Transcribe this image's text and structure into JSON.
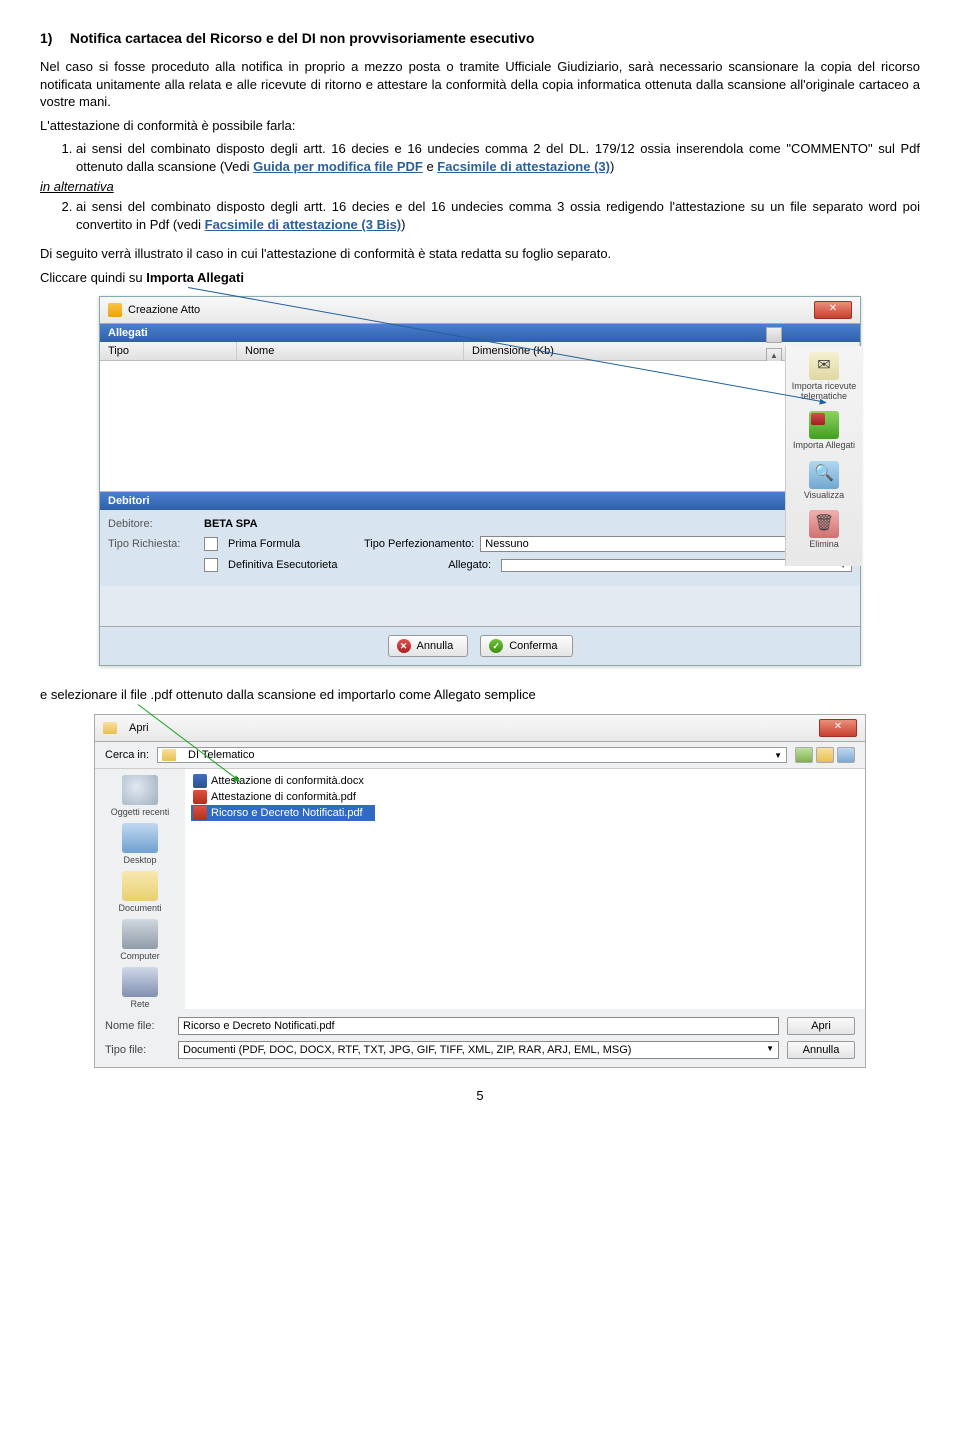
{
  "heading": {
    "number": "1)",
    "title": "Notifica cartacea del Ricorso e del DI non provvisoriamente esecutivo"
  },
  "p1": "Nel caso si fosse proceduto alla notifica in proprio a mezzo posta o tramite Ufficiale Giudiziario, sarà necessario scansionare la copia del ricorso notificata unitamente alla relata e alle ricevute di ritorno e attestare la conformità della copia informatica ottenuta dalla scansione all'originale cartaceo a vostre mani.",
  "p2": "L'attestazione di conformità è possibile farla:",
  "li1a": "ai sensi del combinato disposto degli artt. 16 decies e 16 undecies comma 2 del DL. 179/12 ossia inserendola come \"COMMENTO\" sul Pdf ottenuto dalla scansione (Vedi ",
  "link1": "Guida per modifica file PDF",
  "li1b": " e ",
  "link2": "Facsimile di attestazione (3)",
  "li1c": ")",
  "alt": "in alternativa",
  "li2a": "ai sensi del combinato disposto degli artt. 16 decies e del 16 undecies comma 3 ossia redigendo l'attestazione su un file separato word poi convertito in Pdf (vedi ",
  "link3": "Facsimile di attestazione (3 Bis)",
  "li2b": ")",
  "p3a": "Di seguito verrà illustrato il caso in cui l'attestazione di conformità è stata redatta su foglio separato.",
  "p4a": "Cliccare quindi su ",
  "p4b": "Importa Allegati",
  "shot1": {
    "title": "Creazione Atto",
    "sec1": "Allegati",
    "th1": "Tipo",
    "th2": "Nome",
    "th3": "Dimensione (Kb)",
    "tool1": "Importa ricevute telematiche",
    "tool2": "Importa Allegati",
    "tool3": "Visualizza",
    "tool4": "Elimina",
    "sec2": "Debitori",
    "dl1": "Debitore:",
    "dv1": "BETA SPA",
    "dl2": "Tipo Richiesta:",
    "chk1": "Prima Formula",
    "dl3": "Tipo Perfezionamento:",
    "sel1": "Nessuno",
    "chk2": "Definitiva Esecutorieta",
    "dl4": "Allegato:",
    "btn1": "Annulla",
    "btn2": "Conferma"
  },
  "p5": "e selezionare il file .pdf ottenuto dalla scansione ed importarlo come Allegato semplice",
  "shot2": {
    "title": "Apri",
    "loc_label": "Cerca in:",
    "loc_val": "DI Telematico",
    "place1": "Oggetti recenti",
    "place2": "Desktop",
    "place3": "Documenti",
    "place4": "Computer",
    "place5": "Rete",
    "file1": "Attestazione di conformità.docx",
    "file2": "Attestazione di conformità.pdf",
    "file3": "Ricorso e Decreto Notificati.pdf",
    "fl1": "Nome file:",
    "fv1": "Ricorso e Decreto Notificati.pdf",
    "fl2": "Tipo file:",
    "fv2": "Documenti (PDF, DOC, DOCX, RTF, TXT, JPG, GIF, TIFF, XML, ZIP, RAR, ARJ, EML, MSG)",
    "btn1": "Apri",
    "btn2": "Annulla"
  },
  "pagenum": "5"
}
